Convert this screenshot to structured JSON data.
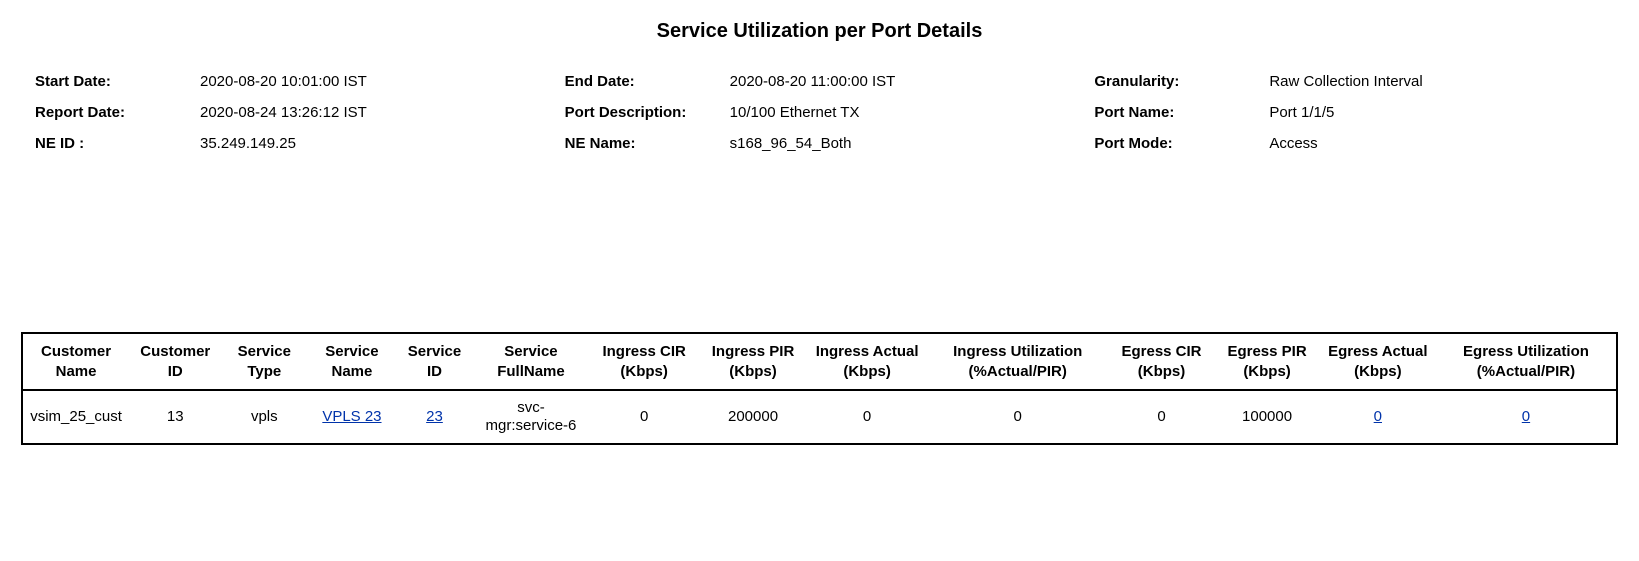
{
  "title": "Service Utilization per Port Details",
  "meta": {
    "start_date": {
      "label": "Start Date:",
      "value": "2020-08-20 10:01:00 IST"
    },
    "end_date": {
      "label": "End Date:",
      "value": "2020-08-20 11:00:00 IST"
    },
    "granularity": {
      "label": "Granularity:",
      "value": "Raw Collection Interval"
    },
    "report_date": {
      "label": "Report Date:",
      "value": "2020-08-24 13:26:12 IST"
    },
    "port_description": {
      "label": "Port Description:",
      "value": "10/100 Ethernet TX"
    },
    "port_name": {
      "label": "Port Name:",
      "value": "Port 1/1/5"
    },
    "ne_id": {
      "label": "NE ID :",
      "value": "35.249.149.25"
    },
    "ne_name": {
      "label": "NE Name:",
      "value": "s168_96_54_Both"
    },
    "port_mode": {
      "label": "Port Mode:",
      "value": "Access"
    }
  },
  "table": {
    "headers": {
      "customer_name": "Customer Name",
      "customer_id": "Customer ID",
      "service_type": "Service Type",
      "service_name": "Service Name",
      "service_id": "Service ID",
      "service_fullname": "Service FullName",
      "ingress_cir": "Ingress CIR (Kbps)",
      "ingress_pir": "Ingress PIR (Kbps)",
      "ingress_actual": "Ingress Actual (Kbps)",
      "ingress_util": "Ingress Utilization (%Actual/PIR)",
      "egress_cir": "Egress CIR (Kbps)",
      "egress_pir": "Egress PIR (Kbps)",
      "egress_actual": "Egress Actual (Kbps)",
      "egress_util": "Egress Utilization (%Actual/PIR)"
    },
    "rows": [
      {
        "customer_name": "vsim_25_cust",
        "customer_id": "13",
        "service_type": "vpls",
        "service_name": "VPLS 23",
        "service_id": "23",
        "service_fullname": "svc-mgr:service-6",
        "ingress_cir": "0",
        "ingress_pir": "200000",
        "ingress_actual": "0",
        "ingress_util": "0",
        "egress_cir": "0",
        "egress_pir": "100000",
        "egress_actual": "0",
        "egress_util": "0"
      }
    ]
  }
}
